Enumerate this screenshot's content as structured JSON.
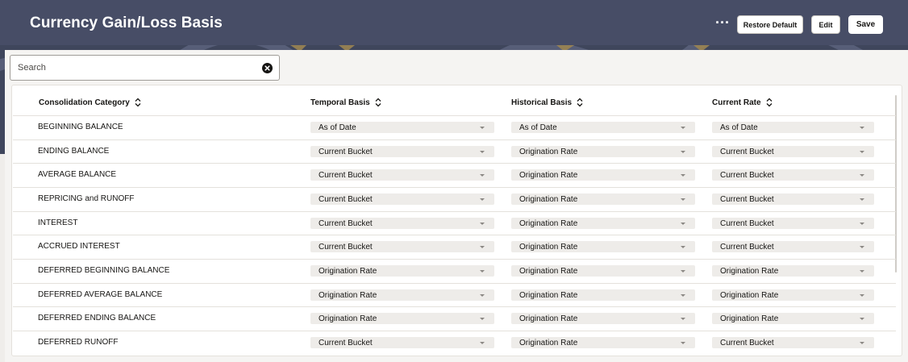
{
  "header": {
    "title": "Currency Gain/Loss Basis",
    "more_label": "···",
    "restore_label": "Restore Default",
    "edit_label": "Edit",
    "save_label": "Save"
  },
  "search": {
    "placeholder": "Search",
    "value": "",
    "clear_icon": "clear-circle-icon"
  },
  "table": {
    "columns": [
      "Consolidation Category",
      "Temporal Basis",
      "Historical Basis",
      "Current Rate"
    ],
    "rows": [
      {
        "category": "BEGINNING BALANCE",
        "temporal": "As of Date",
        "historical": "As of Date",
        "current": "As of Date"
      },
      {
        "category": "ENDING BALANCE",
        "temporal": "Current Bucket",
        "historical": "Origination Rate",
        "current": "Current Bucket"
      },
      {
        "category": "AVERAGE BALANCE",
        "temporal": "Current Bucket",
        "historical": "Origination Rate",
        "current": "Current Bucket"
      },
      {
        "category": "REPRICING and RUNOFF",
        "temporal": "Current Bucket",
        "historical": "Origination Rate",
        "current": "Current Bucket"
      },
      {
        "category": "INTEREST",
        "temporal": "Current Bucket",
        "historical": "Origination Rate",
        "current": "Current Bucket"
      },
      {
        "category": "ACCRUED INTEREST",
        "temporal": "Current Bucket",
        "historical": "Origination Rate",
        "current": "Current Bucket"
      },
      {
        "category": "DEFERRED BEGINNING BALANCE",
        "temporal": "Origination Rate",
        "historical": "Origination Rate",
        "current": "Origination Rate"
      },
      {
        "category": "DEFERRED AVERAGE BALANCE",
        "temporal": "Origination Rate",
        "historical": "Origination Rate",
        "current": "Origination Rate"
      },
      {
        "category": "DEFERRED ENDING BALANCE",
        "temporal": "Origination Rate",
        "historical": "Origination Rate",
        "current": "Origination Rate"
      },
      {
        "category": "DEFERRED RUNOFF",
        "temporal": "Current Bucket",
        "historical": "Origination Rate",
        "current": "Current Bucket"
      }
    ]
  },
  "colors": {
    "header_bg": "#3f465c",
    "accent": "#e8b84a",
    "panel_bg": "#f5f4f2"
  }
}
